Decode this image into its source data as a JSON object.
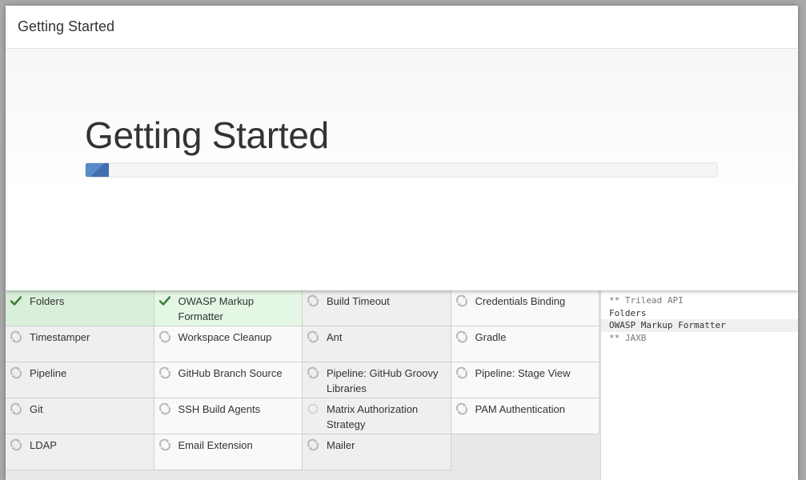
{
  "dialog": {
    "title": "Getting Started"
  },
  "hero": {
    "title": "Getting Started",
    "progress_fraction": 0.037
  },
  "colors": {
    "installed": "#d9efd9",
    "check": "#3f7f3f",
    "spinner": "#b8b8b8",
    "progress": "#5a8bc9"
  },
  "plugins": [
    {
      "label": "Folders",
      "status": "done",
      "icon": "check-icon"
    },
    {
      "label": "OWASP Markup Formatter",
      "status": "done",
      "icon": "check-icon"
    },
    {
      "label": "Build Timeout",
      "status": "pending",
      "icon": "refresh-icon"
    },
    {
      "label": "Credentials Binding",
      "status": "pending",
      "icon": "refresh-icon"
    },
    {
      "label": "Timestamper",
      "status": "pending",
      "icon": "refresh-icon"
    },
    {
      "label": "Workspace Cleanup",
      "status": "pending",
      "icon": "refresh-icon"
    },
    {
      "label": "Ant",
      "status": "pending",
      "icon": "refresh-icon"
    },
    {
      "label": "Gradle",
      "status": "pending",
      "icon": "refresh-icon"
    },
    {
      "label": "Pipeline",
      "status": "pending",
      "icon": "refresh-icon"
    },
    {
      "label": "GitHub Branch Source",
      "status": "pending",
      "icon": "refresh-icon"
    },
    {
      "label": "Pipeline: GitHub Groovy Libraries",
      "status": "pending",
      "icon": "refresh-icon"
    },
    {
      "label": "Pipeline: Stage View",
      "status": "pending",
      "icon": "refresh-icon"
    },
    {
      "label": "Git",
      "status": "pending",
      "icon": "refresh-icon"
    },
    {
      "label": "SSH Build Agents",
      "status": "pending",
      "icon": "refresh-icon"
    },
    {
      "label": "Matrix Authorization Strategy",
      "status": "queued",
      "icon": "circle-icon"
    },
    {
      "label": "PAM Authentication",
      "status": "pending",
      "icon": "refresh-icon"
    },
    {
      "label": "LDAP",
      "status": "pending",
      "icon": "refresh-icon"
    },
    {
      "label": "Email Extension",
      "status": "pending",
      "icon": "refresh-icon"
    },
    {
      "label": "Mailer",
      "status": "pending",
      "icon": "refresh-icon"
    }
  ],
  "log": [
    {
      "text": "** Trilead API",
      "style": "muted"
    },
    {
      "text": "Folders",
      "style": "normal"
    },
    {
      "text": "OWASP Markup Formatter",
      "style": "hl"
    },
    {
      "text": "** JAXB",
      "style": "muted"
    }
  ]
}
